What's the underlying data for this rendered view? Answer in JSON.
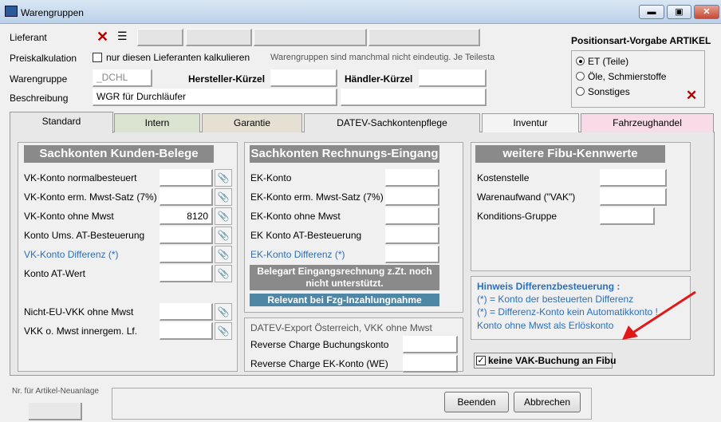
{
  "window": {
    "title": "Warengruppen",
    "min": "▬",
    "max": "▣",
    "close": "✕"
  },
  "header": {
    "lieferant_label": "Lieferant",
    "preiskalk_label": "Preiskalkulation",
    "preiskalk_checkbox_label": "nur diesen Lieferanten kalkulieren",
    "hint": "Warengruppen sind manchmal nicht eindeutig. Je Teilesta",
    "warengruppe_label": "Warengruppe",
    "warengruppe_value": "_DCHL",
    "hersteller_label": "Hersteller-Kürzel",
    "haendler_label": "Händler-Kürzel",
    "beschreibung_label": "Beschreibung",
    "beschreibung_value": "WGR für Durchläufer"
  },
  "positionsart": {
    "title": "Positionsart-Vorgabe ARTIKEL",
    "options": [
      "ET (Teile)",
      "Öle, Schmierstoffe",
      "Sonstiges"
    ],
    "selected": 0
  },
  "tabs": [
    "Standard",
    "Intern",
    "Garantie",
    "DATEV-Sachkontenpflege",
    "Inventur",
    "Fahrzeughandel"
  ],
  "kunden": {
    "title": "Sachkonten Kunden-Belege",
    "rows": [
      {
        "label": "VK-Konto normalbesteuert",
        "value": ""
      },
      {
        "label": "VK-Konto erm. Mwst-Satz (7%)",
        "value": ""
      },
      {
        "label": "VK-Konto ohne Mwst",
        "value": "8120"
      },
      {
        "label": "Konto Ums. AT-Besteuerung",
        "value": ""
      },
      {
        "label": "VK-Konto Differenz (*)",
        "value": ""
      },
      {
        "label": "Konto AT-Wert",
        "value": ""
      },
      {
        "label": "Nicht-EU-VKK ohne Mwst",
        "value": ""
      },
      {
        "label": "VKK o. Mwst innergem. Lf.",
        "value": ""
      }
    ]
  },
  "eingang": {
    "title": "Sachkonten Rechnungs-Eingang",
    "rows": [
      "EK-Konto",
      "EK-Konto erm. Mwst-Satz (7%)",
      "EK-Konto ohne Mwst",
      "EK Konto AT-Besteuerung",
      "EK-Konto Differenz (*)"
    ],
    "note1": "Belegart Eingangsrechnung z.Zt. noch nicht unterstützt.",
    "note2": "Relevant bei Fzg-Inzahlungnahme"
  },
  "datev": {
    "title": "DATEV-Export Österreich, VKK ohne Mwst",
    "rows": [
      "Reverse Charge Buchungskonto",
      "Reverse Charge EK-Konto (WE)"
    ]
  },
  "fibu": {
    "title": "weitere Fibu-Kennwerte",
    "rows": [
      "Kostenstelle",
      "Warenaufwand (\"VAK\")",
      "Konditions-Gruppe"
    ]
  },
  "hinweis": {
    "title": "Hinweis Differenzbesteuerung :",
    "line1": "(*) = Konto der besteuerten Differenz",
    "line2": "(*) = Differenz-Konto kein Automatikkonto !",
    "line3": "Konto ohne Mwst als Erlöskonto"
  },
  "vak": {
    "label": "keine VAK-Buchung an Fibu",
    "checked": true
  },
  "footer": {
    "nr_label": "Nr. für Artikel-Neuanlage",
    "beenden": "Beenden",
    "abbrechen": "Abbrechen"
  },
  "colors": {
    "tab_intern": "#d9e3cf",
    "tab_garantie": "#e6e0d2",
    "tab_datev": "#e8e8e8",
    "tab_inventur": "#f4f4f4",
    "tab_fahrzeug": "#f8dbe6",
    "arrow": "#e01818",
    "hint_blue": "#2a6fc0"
  }
}
